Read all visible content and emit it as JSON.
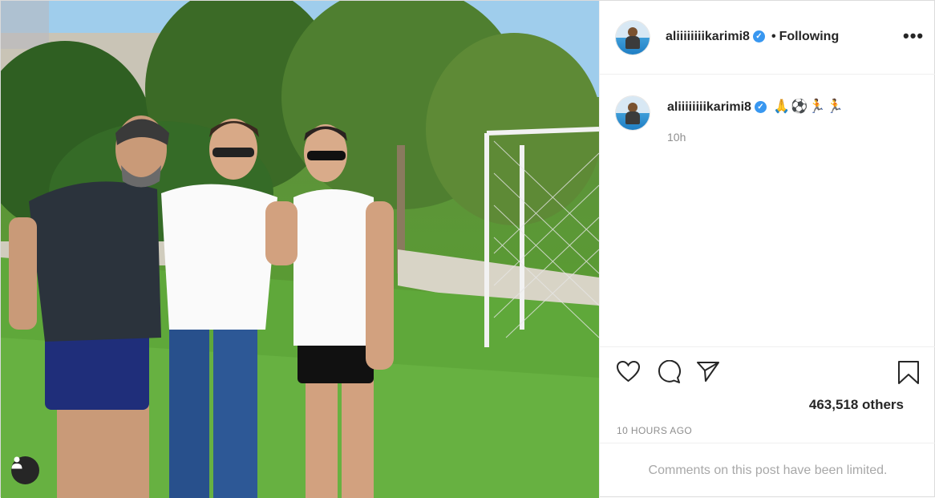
{
  "post": {
    "username": "aliiiiiiiikarimi8",
    "verified_icon": "verified-check-icon",
    "separator": "•",
    "follow_status": "Following",
    "more_icon": "•••",
    "caption_emoji": "🙏⚽🏃🏃",
    "caption_time": "10h",
    "likes_text": "463,518 others",
    "posted_ago": "10 HOURS AGO",
    "comments_notice": "Comments on this post have been limited."
  },
  "icons": {
    "like": "heart-icon",
    "comment": "comment-icon",
    "share": "share-icon",
    "save": "bookmark-icon",
    "tag": "user-tag-icon"
  },
  "colors": {
    "verified": "#3897f0",
    "text": "#262626",
    "muted": "#8e8e8e",
    "border": "#efefef"
  }
}
